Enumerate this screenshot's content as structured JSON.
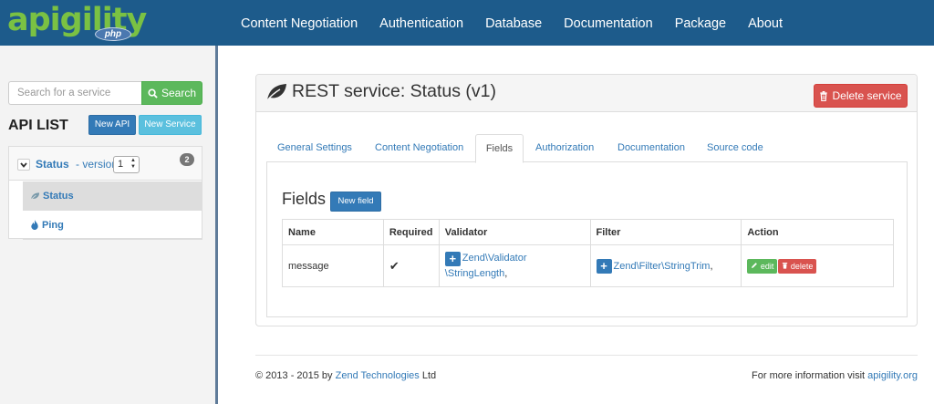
{
  "brand": {
    "name": "apigility",
    "sub": "php"
  },
  "nav": [
    {
      "label": "Content Negotiation"
    },
    {
      "label": "Authentication"
    },
    {
      "label": "Database"
    },
    {
      "label": "Documentation"
    },
    {
      "label": "Package"
    },
    {
      "label": "About"
    }
  ],
  "sidebar": {
    "search_placeholder": "Search for a service",
    "search_button": "Search",
    "api_list_title": "API LIST",
    "new_api_button": "New API",
    "new_service_button": "New Service",
    "api": {
      "name": "Status",
      "version_label": "- version",
      "version_value": "1",
      "service_count": "2",
      "services": [
        {
          "label": "Status",
          "icon": "leaf-icon",
          "active": true
        },
        {
          "label": "Ping",
          "icon": "fire-icon",
          "active": false
        }
      ]
    }
  },
  "panel": {
    "title": "REST service: Status (v1)",
    "title_icon": "leaf-icon",
    "delete_button": "Delete service",
    "tabs": [
      {
        "label": "General Settings"
      },
      {
        "label": "Content Negotiation"
      },
      {
        "label": "Fields",
        "active": true
      },
      {
        "label": "Authorization"
      },
      {
        "label": "Documentation"
      },
      {
        "label": "Source code"
      }
    ],
    "fields_title": "Fields",
    "new_field_button": "New field",
    "table": {
      "headers": [
        "Name",
        "Required",
        "Validator",
        "Filter",
        "Action"
      ],
      "rows": [
        {
          "name": "message",
          "required": "✔",
          "validator_1": "Zend\\Validator",
          "validator_2": "\\StringLength",
          "validator_sep": ",",
          "filter": "Zend\\Filter\\StringTrim",
          "filter_sep": ",",
          "edit_label": "edit",
          "delete_label": "delete"
        }
      ]
    }
  },
  "footer": {
    "copyright": "© 2013 - 2015 by",
    "company": "Zend Technologies",
    "company_suffix": "Ltd",
    "info_text": "For more information visit",
    "info_link": "apigility.org"
  },
  "colors": {
    "navbar": "#1d5b8b",
    "brand": "#7ac143",
    "primary": "#337ab7",
    "success": "#5cb85c",
    "info": "#5bc0de",
    "danger": "#d9534f"
  }
}
